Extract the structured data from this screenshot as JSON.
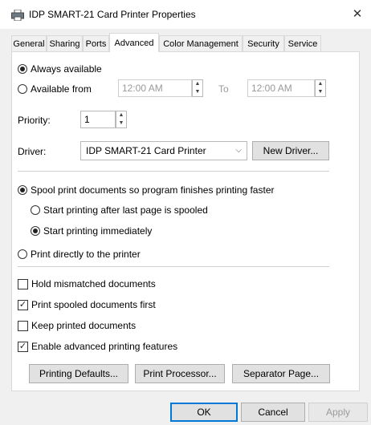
{
  "window": {
    "title": "IDP SMART-21 Card Printer Properties",
    "close_glyph": "✕"
  },
  "tabs": [
    {
      "label": "General"
    },
    {
      "label": "Sharing"
    },
    {
      "label": "Ports"
    },
    {
      "label": "Advanced"
    },
    {
      "label": "Color Management"
    },
    {
      "label": "Security"
    },
    {
      "label": "Service"
    }
  ],
  "active_tab": "Advanced",
  "availability": {
    "always_label": "Always available",
    "from_label": "Available from",
    "from_time": "12:00 AM",
    "to_label": "To",
    "to_time": "12:00 AM",
    "selected": "always"
  },
  "priority": {
    "label": "Priority:",
    "value": "1"
  },
  "driver": {
    "label": "Driver:",
    "selected": "IDP SMART-21 Card Printer",
    "new_driver_button": "New Driver..."
  },
  "spooling": {
    "spool_label": "Spool print documents so program finishes printing faster",
    "after_last_page_label": "Start printing after last page is spooled",
    "immediately_label": "Start printing immediately",
    "direct_label": "Print directly to the printer",
    "selected_mode": "spool",
    "selected_start": "immediately"
  },
  "options": [
    {
      "label": "Hold mismatched documents",
      "checked": false
    },
    {
      "label": "Print spooled documents first",
      "checked": true
    },
    {
      "label": "Keep printed documents",
      "checked": false
    },
    {
      "label": "Enable advanced printing features",
      "checked": true
    }
  ],
  "panel_buttons": {
    "printing_defaults": "Printing Defaults...",
    "print_processor": "Print Processor...",
    "separator_page": "Separator Page..."
  },
  "dialog_buttons": {
    "ok": "OK",
    "cancel": "Cancel",
    "apply": "Apply"
  },
  "colors": {
    "accent": "#0078d7",
    "panel_bg": "#ffffff",
    "window_bg": "#f0f0f0"
  }
}
